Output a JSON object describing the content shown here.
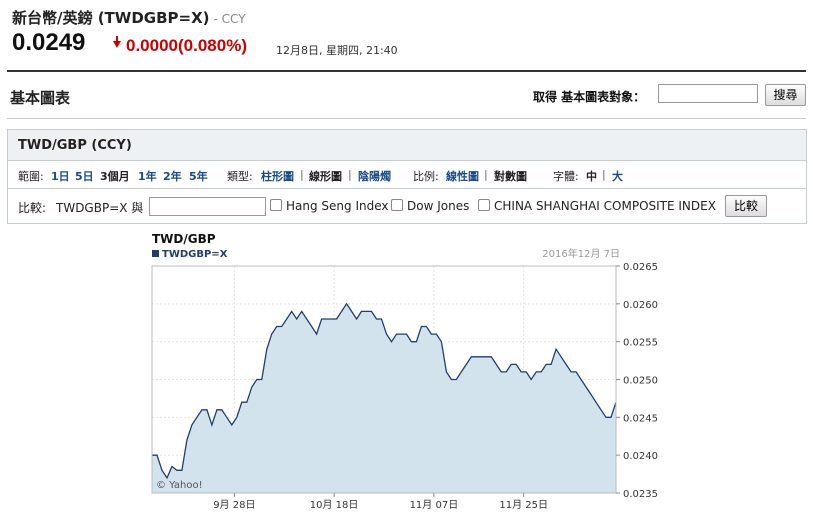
{
  "header": {
    "title": "新台幣/英鎊 (TWDGBP=X)",
    "ccy": "- CCY",
    "price": "0.0249",
    "change": "0.0000(0.080%)",
    "time": "12月8日, 星期四, 21:40"
  },
  "section": {
    "title": "基本圖表",
    "get_label": "取得 基本圖表對象：",
    "get_input_value": "",
    "search_label": "搜尋"
  },
  "panel": {
    "title": "TWD/GBP (CCY)",
    "range_label": "範圍:",
    "ranges": [
      "1日",
      "5日",
      "3個月",
      "1年",
      "2年",
      "5年"
    ],
    "type_label": "類型:",
    "types": [
      "柱形圖",
      "線形圖",
      "陰陽燭"
    ],
    "scale_label": "比例:",
    "scales": [
      "線性圖",
      "對數圖"
    ],
    "font_label": "字體:",
    "fonts": [
      "中",
      "大"
    ],
    "compare_label": "比較:",
    "compare_prefix": "TWDGBP=X 與",
    "compare_input_value": "",
    "checkboxes": [
      "Hang Seng Index",
      "Dow Jones",
      "CHINA SHANGHAI COMPOSITE INDEX"
    ],
    "compare_button": "比較"
  },
  "chart_data": {
    "type": "area",
    "title": "TWD/GBP",
    "legend": "TWDGBP=X",
    "date_label": "2016年12月 7日",
    "watermark": "© Yahoo!",
    "ylim": [
      0.0235,
      0.0265
    ],
    "yticks": [
      "0.0265",
      "0.0260",
      "0.0255",
      "0.0250",
      "0.0245",
      "0.0240",
      "0.0235"
    ],
    "xticks": [
      {
        "label": "9月 28日",
        "x": 16.5
      },
      {
        "label": "10月 18日",
        "x": 36.5
      },
      {
        "label": "11月 07日",
        "x": 56.5
      },
      {
        "label": "11月 25日",
        "x": 74.5
      }
    ],
    "xlim": [
      0,
      93
    ],
    "x": [
      0,
      1,
      2,
      3,
      4,
      5,
      6,
      7,
      8,
      9,
      10,
      11,
      12,
      13,
      14,
      15,
      16,
      17,
      18,
      19,
      20,
      21,
      22,
      23,
      24,
      25,
      26,
      27,
      28,
      29,
      30,
      31,
      32,
      33,
      34,
      35,
      36,
      37,
      38,
      39,
      40,
      41,
      42,
      43,
      44,
      45,
      46,
      47,
      48,
      49,
      50,
      51,
      52,
      53,
      54,
      55,
      56,
      57,
      58,
      59,
      60,
      61,
      62,
      63,
      64,
      65,
      66,
      67,
      68,
      69,
      70,
      71,
      72,
      73,
      74,
      75,
      76,
      77,
      78,
      79,
      80,
      81,
      82,
      83,
      84,
      85,
      86,
      87,
      88,
      89,
      90,
      91,
      92,
      93
    ],
    "values": [
      0.024,
      0.024,
      0.0238,
      0.0237,
      0.02385,
      0.0238,
      0.0238,
      0.0242,
      0.0244,
      0.0245,
      0.0246,
      0.0246,
      0.0244,
      0.0246,
      0.0246,
      0.0245,
      0.0244,
      0.0245,
      0.0247,
      0.0247,
      0.0249,
      0.025,
      0.025,
      0.0254,
      0.0256,
      0.0257,
      0.0257,
      0.0258,
      0.0259,
      0.0258,
      0.0259,
      0.0258,
      0.0257,
      0.0256,
      0.0258,
      0.0258,
      0.0258,
      0.0258,
      0.0259,
      0.026,
      0.0259,
      0.0258,
      0.0259,
      0.0259,
      0.0259,
      0.0258,
      0.0258,
      0.0256,
      0.0255,
      0.0256,
      0.0256,
      0.0256,
      0.0255,
      0.0255,
      0.0257,
      0.0257,
      0.0256,
      0.0256,
      0.0255,
      0.0251,
      0.025,
      0.025,
      0.0251,
      0.0252,
      0.0253,
      0.0253,
      0.0253,
      0.0253,
      0.0253,
      0.0252,
      0.0251,
      0.0251,
      0.0252,
      0.0252,
      0.0251,
      0.0251,
      0.025,
      0.0251,
      0.0251,
      0.0252,
      0.0252,
      0.0254,
      0.0253,
      0.0252,
      0.0251,
      0.0251,
      0.025,
      0.0249,
      0.0248,
      0.0247,
      0.0246,
      0.0245,
      0.0245,
      0.0247
    ]
  },
  "colors": {
    "line": "#1f3f6e",
    "fill": "#d3e3ee",
    "down": "#cc0000",
    "link": "#1a4a8a"
  }
}
